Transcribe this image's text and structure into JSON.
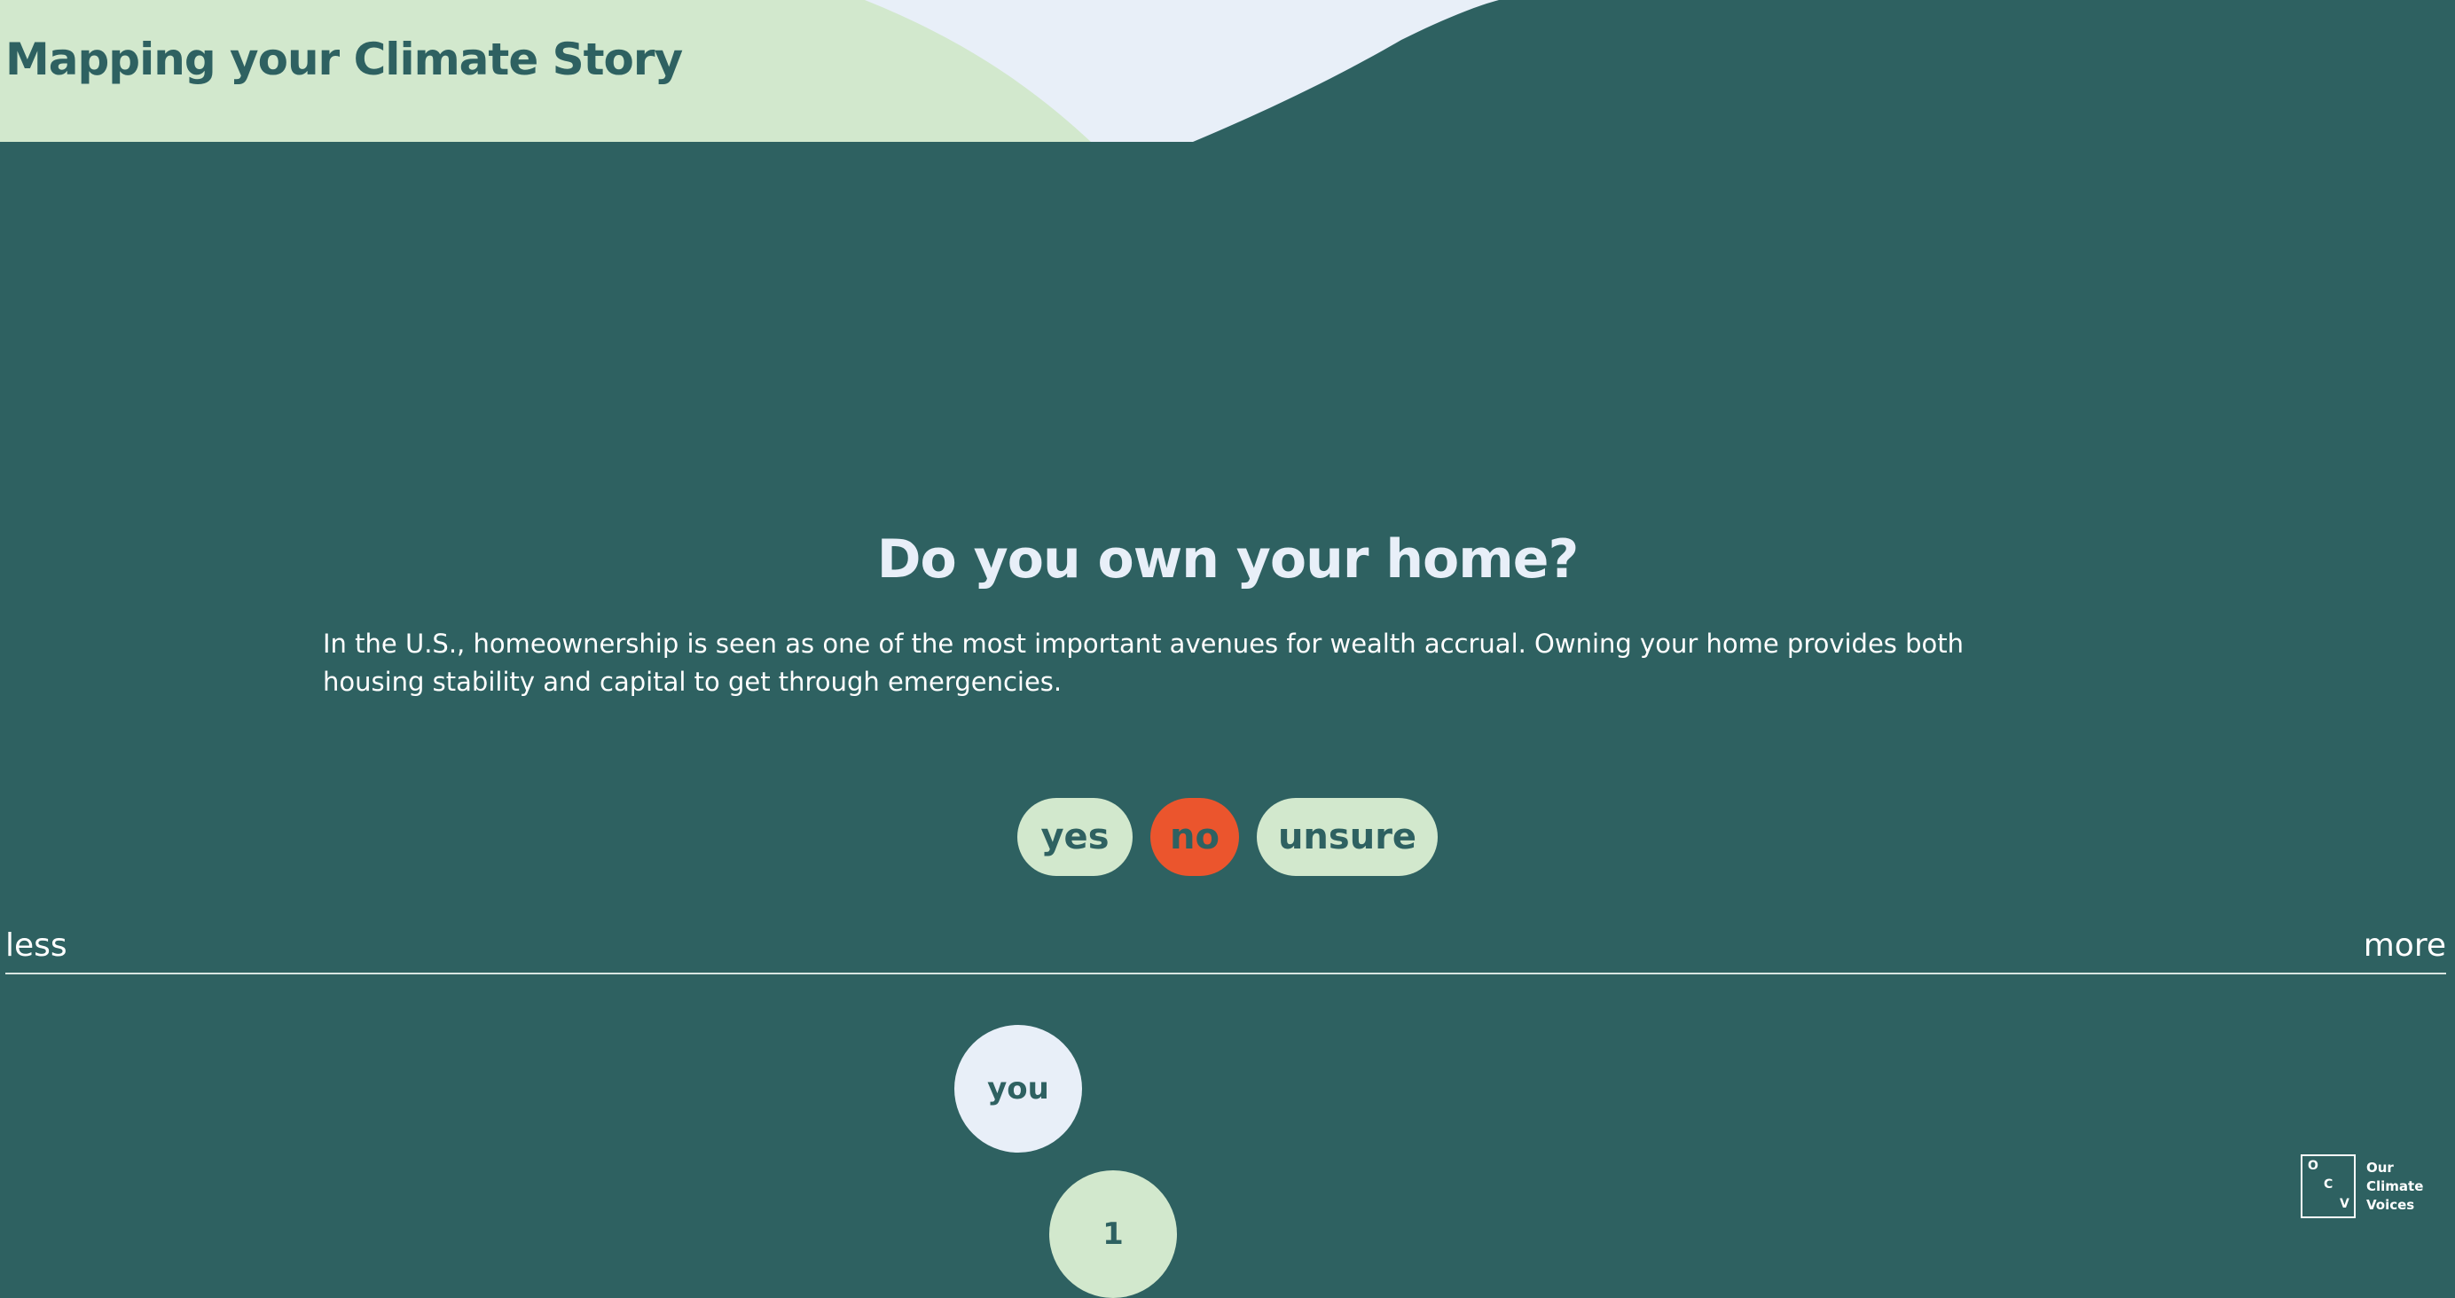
{
  "header": {
    "title": "Mapping your Climate Story"
  },
  "question": {
    "title": "Do you own your home?",
    "description": "In the U.S., homeownership is seen as one of the most important avenues for wealth accrual. Owning your home provides both housing stability and capital to get through emergencies."
  },
  "answers": {
    "yes_label": "yes",
    "no_label": "no",
    "unsure_label": "unsure",
    "selected": "no"
  },
  "scale": {
    "left_label": "less",
    "right_label": "more"
  },
  "bubbles": {
    "you_label": "you",
    "count_label": "1"
  },
  "logo": {
    "letters": [
      "O",
      "C",
      "V"
    ],
    "lines": [
      "Our",
      "Climate",
      "Voices"
    ]
  },
  "colors": {
    "background": "#2e6161",
    "light_green": "#d2e8cd",
    "light_blue": "#e8eff8",
    "accent_orange": "#eb552d"
  }
}
